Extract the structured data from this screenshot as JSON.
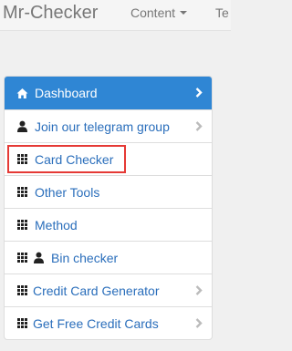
{
  "navbar": {
    "brand": "Mr-Checker",
    "items": [
      {
        "label": "Content"
      },
      {
        "label": "Te"
      }
    ]
  },
  "menu": {
    "items": [
      {
        "label": "Dashboard",
        "icon": "home-icon",
        "active": true,
        "has_chevron": true
      },
      {
        "label": "Join our telegram group",
        "icon": "user-icon",
        "active": false,
        "has_chevron": true
      },
      {
        "label": "Card Checker",
        "icon": "grid-icon",
        "active": false,
        "has_chevron": false,
        "highlighted": true
      },
      {
        "label": "Other Tools",
        "icon": "grid-icon",
        "active": false,
        "has_chevron": false
      },
      {
        "label": "Method",
        "icon": "grid-icon",
        "active": false,
        "has_chevron": false
      },
      {
        "label": "Bin checker",
        "icon": "grid-icon",
        "icon2": "user-icon",
        "active": false,
        "has_chevron": false
      },
      {
        "label": "Credit Card Generator",
        "icon": "grid-icon",
        "active": false,
        "has_chevron": true
      },
      {
        "label": "Get Free Credit Cards",
        "icon": "grid-icon",
        "active": false,
        "has_chevron": true
      }
    ]
  },
  "colors": {
    "accent": "#2f86d4",
    "link": "#2a6ebb",
    "highlight_border": "#e53935",
    "navbar_text": "#777777"
  }
}
